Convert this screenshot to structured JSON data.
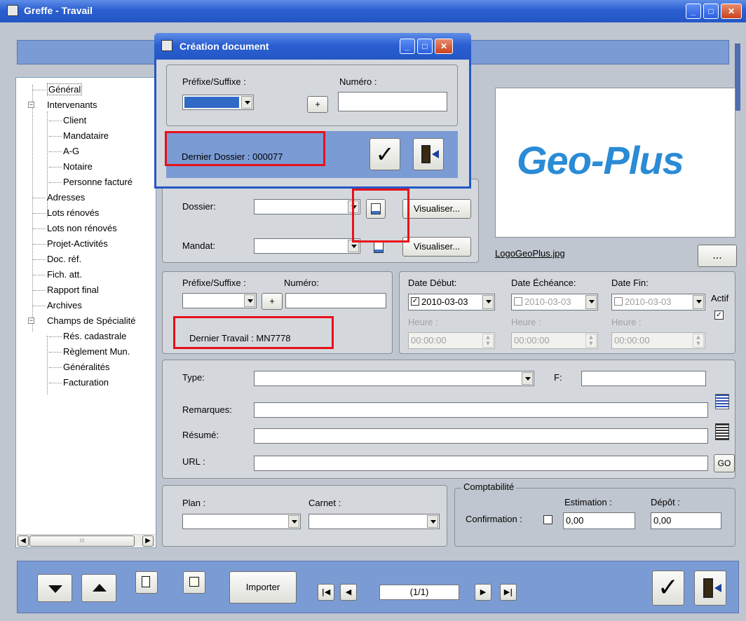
{
  "main_window": {
    "title": "Greffe - Travail"
  },
  "tree": {
    "items": [
      {
        "label": "Général"
      },
      {
        "label": "Intervenants"
      },
      {
        "label": "Client"
      },
      {
        "label": "Mandataire"
      },
      {
        "label": "A-G"
      },
      {
        "label": "Notaire"
      },
      {
        "label": "Personne facturé"
      },
      {
        "label": "Adresses"
      },
      {
        "label": "Lots rénovés"
      },
      {
        "label": "Lots non rénovés"
      },
      {
        "label": "Projet-Activités"
      },
      {
        "label": "Doc. réf."
      },
      {
        "label": "Fich. att."
      },
      {
        "label": "Rapport final"
      },
      {
        "label": "Archives"
      },
      {
        "label": "Champs de Spécialité"
      },
      {
        "label": "Rés. cadastrale"
      },
      {
        "label": "Règlement Mun."
      },
      {
        "label": "Généralités"
      },
      {
        "label": "Facturation"
      }
    ],
    "scroll_label": "III"
  },
  "dialog": {
    "title": "Création document",
    "prefix_label": "Préfixe/Suffixe :",
    "numero_label": "Numéro :",
    "numero_value": "",
    "plus_label": "+",
    "last_dossier": "Dernier Dossier : 000077"
  },
  "dossier": {
    "dossier_label": "Dossier:",
    "mandat_label": "Mandat:",
    "visualiser_label": "Visualiser..."
  },
  "logo": {
    "text": "Geo-Plus",
    "filename": "LogoGeoPlus.jpg",
    "browse_label": "..."
  },
  "travail": {
    "prefix_label": "Préfixe/Suffixe :",
    "numero_label": "Numéro:",
    "plus_label": "+",
    "last_travail": "Dernier Travail : MN7778"
  },
  "dates": {
    "debut_label": "Date Début:",
    "echeance_label": "Date Échéance:",
    "fin_label": "Date Fin:",
    "debut_value": "2010-03-03",
    "echeance_value": "2010-03-03",
    "fin_value": "2010-03-03",
    "heure_label": "Heure :",
    "time_value": "00:00:00",
    "actif_label": "Actif"
  },
  "details": {
    "type_label": "Type:",
    "f_label": "F:",
    "remarques_label": "Remarques:",
    "resume_label": "Résumé:",
    "url_label": "URL :",
    "go_label": "GO"
  },
  "plan": {
    "plan_label": "Plan :",
    "carnet_label": "Carnet :"
  },
  "comptabilite": {
    "title": "Comptabilité",
    "confirmation_label": "Confirmation :",
    "estimation_label": "Estimation :",
    "depot_label": "Dépôt :",
    "estimation_value": "0,00",
    "depot_value": "0,00"
  },
  "toolbar": {
    "importer_label": "Importer",
    "record_position": "(1/1)"
  },
  "colors": {
    "xp_title": "#2457c5",
    "red_highlight": "#e8101a",
    "geo_blue": "#2a8bd6"
  }
}
